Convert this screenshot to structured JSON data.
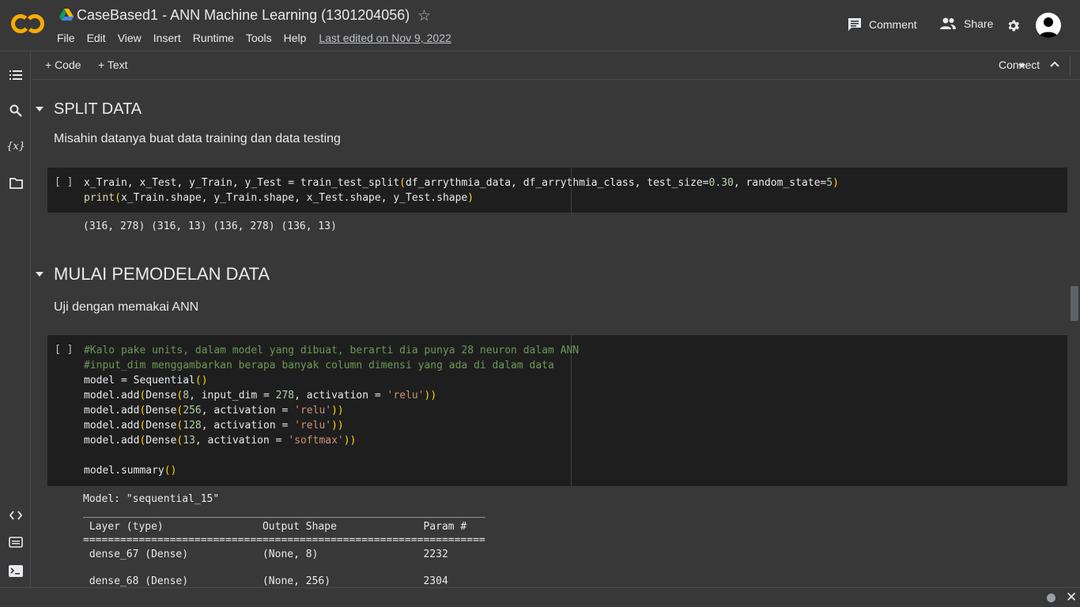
{
  "header": {
    "title": "CaseBased1 - ANN Machine Learning (1301204056)",
    "menu": [
      "File",
      "Edit",
      "View",
      "Insert",
      "Runtime",
      "Tools",
      "Help"
    ],
    "last_edited": "Last edited on Nov 9, 2022",
    "comment_label": "Comment",
    "share_label": "Share"
  },
  "toolbar": {
    "add_code": "+ Code",
    "add_text": "+ Text",
    "connect": "Connect"
  },
  "sections": {
    "split": {
      "title": "SPLIT DATA",
      "description": "Misahin datanya buat data training dan data testing"
    },
    "model": {
      "title": "MULAI PEMODELAN DATA",
      "description": "Uji dengan memakai ANN"
    }
  },
  "cells": {
    "split_run": "[ ]",
    "split_output": "(316, 278) (316, 13) (136, 278) (136, 13)",
    "model_run": "[ ]",
    "summary_output": "Model: \"sequential_15\"\n_________________________________________________________________\n Layer (type)                Output Shape              Param #   \n=================================================================\n dense_67 (Dense)            (None, 8)                 2232      \n                                                                 \n dense_68 (Dense)            (None, 256)               2304      "
  },
  "colors": {
    "background": "#383838",
    "cell_background": "#1e1e1e",
    "string": "#ce9178",
    "number": "#b5cea8",
    "comment": "#6a9955",
    "paren": "#ffd700"
  }
}
